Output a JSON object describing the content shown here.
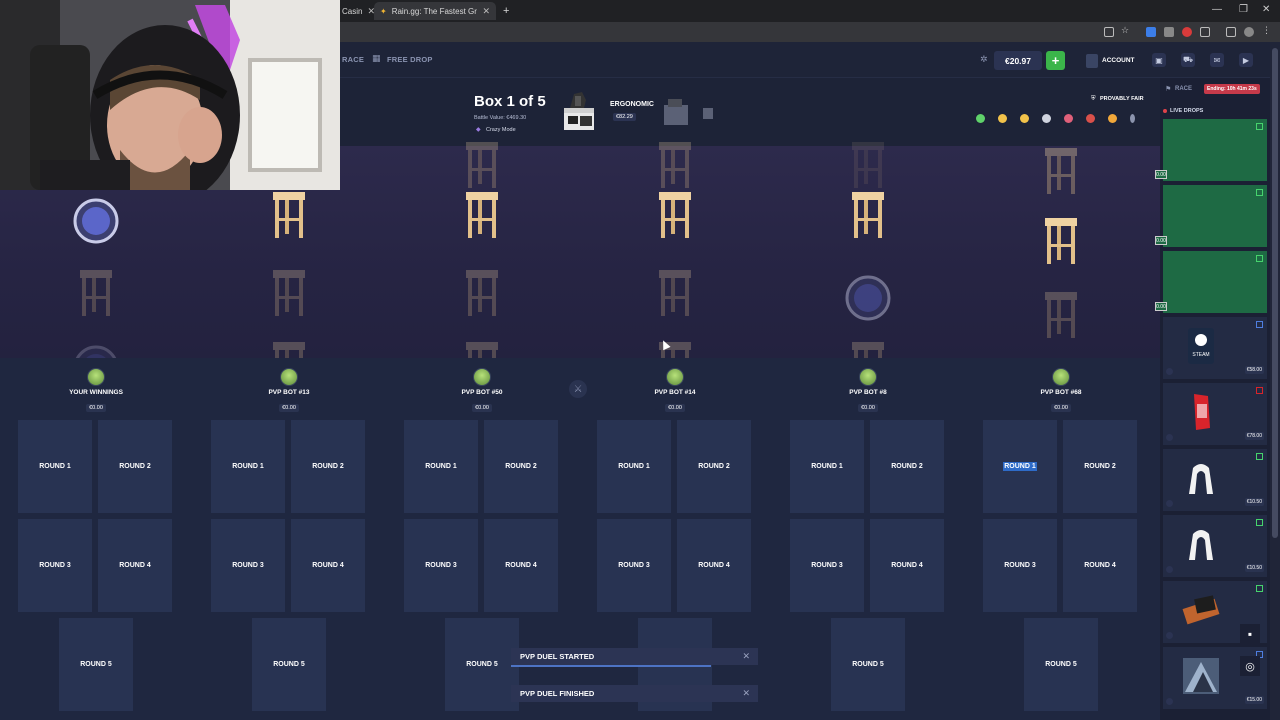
{
  "browser": {
    "tabs": [
      {
        "label": "Casin",
        "active": false
      },
      {
        "label": "Rain.gg: The Fastest Growing C",
        "active": true
      }
    ],
    "new_tab_icon": "plus-icon"
  },
  "header": {
    "nav": [
      {
        "label": "RACE",
        "icon": "race-icon"
      },
      {
        "label": "FREE DROP",
        "icon": "gift-icon"
      }
    ],
    "balance": "€20.97",
    "deposit_label": "+",
    "account_label": "ACCOUNT"
  },
  "battle": {
    "title": "Box 1 of 5",
    "battle_value": "Battle Value: €469.30",
    "mode": "Crazy Mode",
    "box_name": "ERGONOMIC",
    "box_price": "€82.29",
    "provably_fair": "PROVABLY FAIR"
  },
  "players": [
    {
      "name": "YOUR WINNINGS",
      "value": "€0.00"
    },
    {
      "name": "PVP BOT #13",
      "value": "€0.00"
    },
    {
      "name": "PVP BOT #50",
      "value": "€0.00"
    },
    {
      "name": "PVP BOT #14",
      "value": "€0.00"
    },
    {
      "name": "PVP BOT #8",
      "value": "€0.00"
    },
    {
      "name": "PVP BOT #68",
      "value": "€0.00"
    }
  ],
  "rounds": {
    "r1": "ROUND 1",
    "r2": "ROUND 2",
    "r3": "ROUND 3",
    "r4": "ROUND 4",
    "r5": "ROUND 5"
  },
  "toasts": {
    "started": "PVP DUEL STARTED",
    "finished": "PVP DUEL FINISHED"
  },
  "sidebar": {
    "race_label": "RACE",
    "race_ending": "Ending: 10h 41m 23s",
    "live_drops": "LIVE DROPS",
    "tag": "0.00",
    "steam_label": "STEAM",
    "drops": [
      {
        "price": ""
      },
      {
        "price": ""
      },
      {
        "price": ""
      },
      {
        "price": "€58.00"
      },
      {
        "price": "€78.00"
      },
      {
        "price": "€10.50"
      },
      {
        "price": "€10.50"
      },
      {
        "price": ""
      },
      {
        "price": "€15.00"
      }
    ]
  },
  "colors": {
    "background": "#1b2136",
    "reel": "#2d2a4c",
    "accent_green": "#3bb54a",
    "highlight_blue": "#2e6bc8",
    "race_red": "#c63a4a"
  }
}
